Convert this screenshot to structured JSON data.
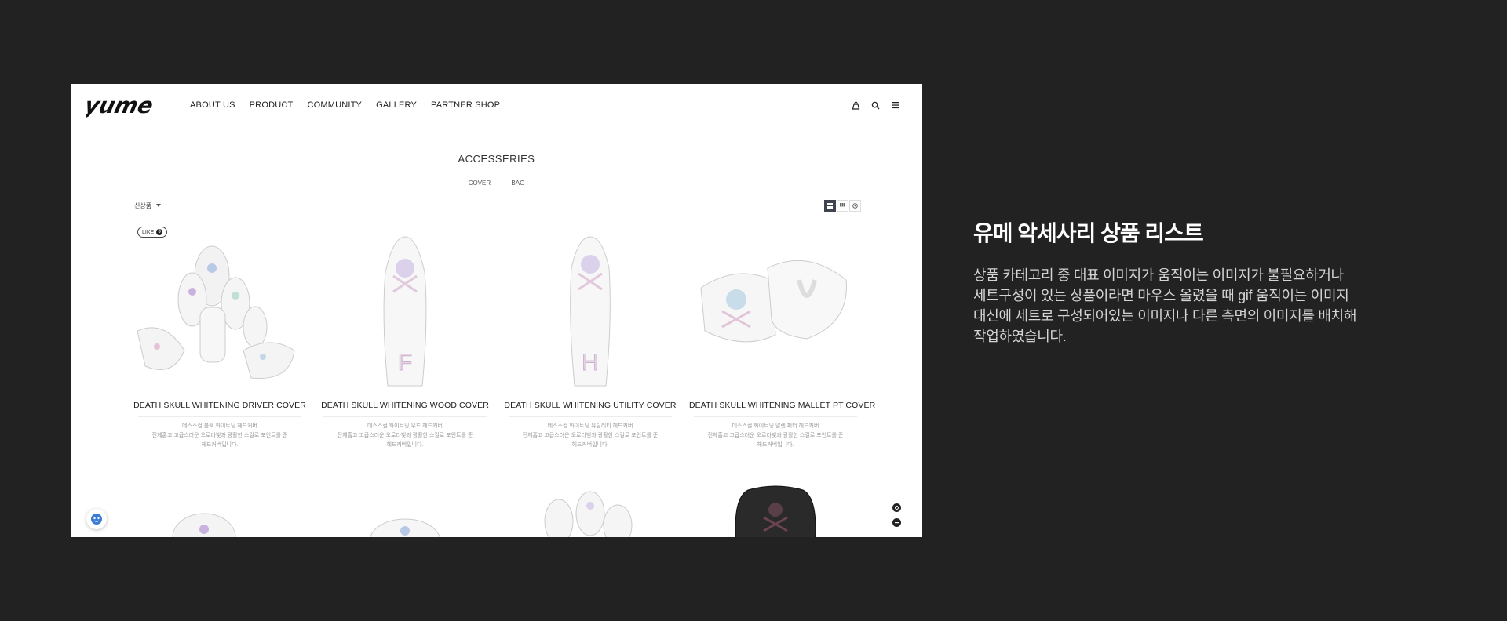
{
  "site": {
    "logo_text": "yume",
    "nav": [
      "ABOUT US",
      "PRODUCT",
      "COMMUNITY",
      "GALLERY",
      "PARTNER SHOP"
    ],
    "icons": [
      "cart-icon",
      "search-icon",
      "hamburger-menu-icon"
    ]
  },
  "listing": {
    "title": "ACCESSERIES",
    "subcategories": [
      "COVER",
      "BAG"
    ],
    "sort_value": "신상품",
    "like_label": "LIKE",
    "like_count": "0",
    "view_icons": [
      "grid-large-icon",
      "grid-small-icon",
      "list-view-icon"
    ]
  },
  "products": [
    {
      "name": "DEATH SKULL WHITENING DRIVER COVER",
      "desc": [
        "데스스컬 블랙 화이트닝 헤드커버",
        "전체흡고 고급스러운 오로라빛과 광활한 스컬로 포인트를 준",
        "헤드커버입니다."
      ]
    },
    {
      "name": "DEATH SKULL WHITENING WOOD COVER",
      "desc": [
        "데스스컬 화이트닝 우드 헤드커버",
        "전체흡고 고급스러운 오로라빛과 광활한 스컬로 포인트를 준",
        "헤드커버입니다."
      ]
    },
    {
      "name": "DEATH SKULL WHITENING UTILITY COVER",
      "desc": [
        "데스스컬 화이트닝 유틸리티 헤드커버",
        "전체흡고 고급스러운 오로라빛과 광활한 스컬로 포인트를 준",
        "헤드커버입니다."
      ]
    },
    {
      "name": "DEATH SKULL WHITENING MALLET PT COVER",
      "desc": [
        "데스스컬 화이트닝 말렛 퍼터 헤드커버",
        "전체흡고 고급스러운 오로라빛과 광활한 스컬로 포인트를 준",
        "헤드커버입니다."
      ]
    }
  ],
  "description": {
    "title": "유메 악세사리 상품 리스트",
    "lines": [
      "상품 카테고리 중 대표 이미지가 움직이는 이미지가 불필요하거나",
      "세트구성이 있는 상품이라면 마우스 올렸을 때 gif 움직이는 이미지",
      "대신에 세트로 구성되어있는 이미지나 다른 측면의 이미지를 배치해",
      "작업하였습니다."
    ]
  },
  "colors": {
    "background": "#222222",
    "page": "#ffffff",
    "accent": "#3f4450",
    "text_light": "#d4d4d4"
  }
}
